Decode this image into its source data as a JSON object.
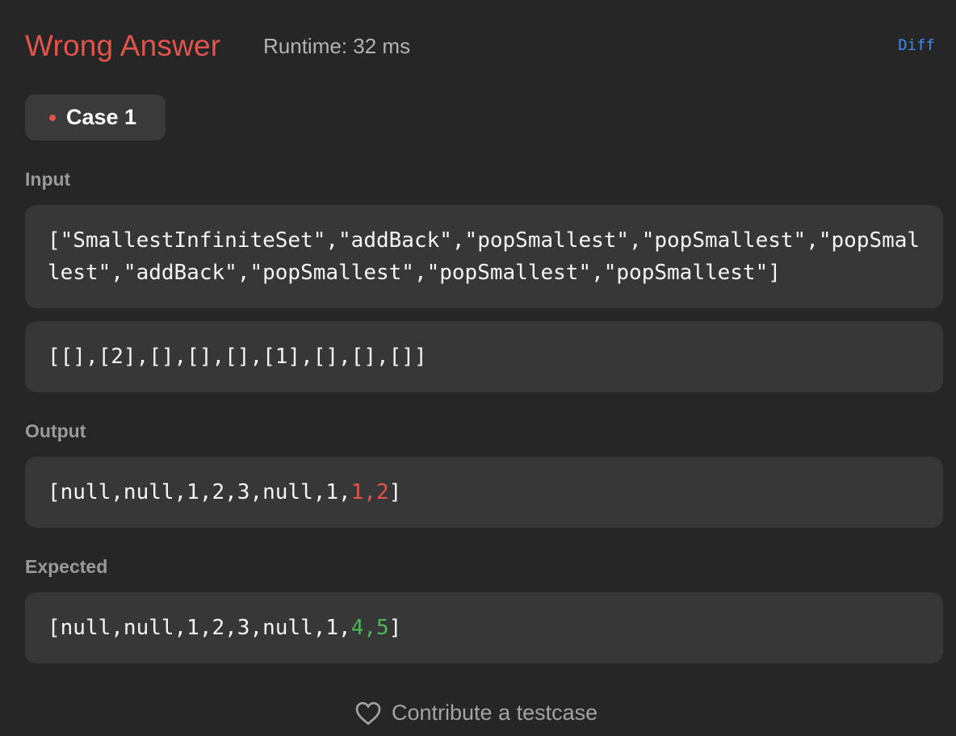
{
  "header": {
    "verdict": "Wrong Answer",
    "runtime": "Runtime: 32 ms",
    "diff_label": "Diff"
  },
  "case_tab": {
    "label": "Case 1",
    "status_color": "#e0544b"
  },
  "input": {
    "label": "Input",
    "line1": "[\"SmallestInfiniteSet\",\"addBack\",\"popSmallest\",\"popSmallest\",\"popSmallest\",\"addBack\",\"popSmallest\",\"popSmallest\",\"popSmallest\"]",
    "line2": "[[],[2],[],[],[],[1],[],[],[]]"
  },
  "output": {
    "label": "Output",
    "prefix": "[null,null,1,2,3,null,1,",
    "highlight": "1,2",
    "suffix": "]"
  },
  "expected": {
    "label": "Expected",
    "prefix": "[null,null,1,2,3,null,1,",
    "highlight": "4,5",
    "suffix": "]"
  },
  "footer": {
    "contribute_label": "Contribute a testcase",
    "icon": "heart-icon"
  },
  "colors": {
    "error": "#e0544b",
    "success": "#4fb75b",
    "link": "#3f8cf2"
  }
}
